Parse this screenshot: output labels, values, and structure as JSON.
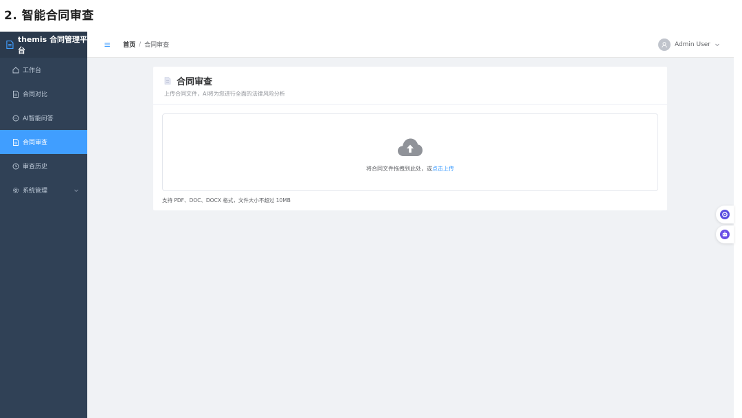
{
  "doc": {
    "heading": "2. 智能合同审查"
  },
  "sidebar": {
    "brand": "themis 合同管理平台",
    "items": [
      {
        "label": "工作台",
        "icon": "home-icon"
      },
      {
        "label": "合同对比",
        "icon": "document-icon"
      },
      {
        "label": "AI智能问答",
        "icon": "chat-icon"
      },
      {
        "label": "合同审查",
        "icon": "document-icon",
        "active": true
      },
      {
        "label": "审查历史",
        "icon": "clock-icon"
      },
      {
        "label": "系统管理",
        "icon": "gear-icon",
        "expandable": true
      }
    ]
  },
  "header": {
    "menu_icon": "hamburger-icon",
    "breadcrumb": {
      "home": "首页",
      "separator": "/",
      "current": "合同审查"
    },
    "user": {
      "name": "Admin User"
    }
  },
  "card": {
    "title": "合同审查",
    "subtitle": "上传合同文件，AI将为您进行全面的法律风险分析",
    "upload": {
      "prompt": "将合同文件拖拽到此处，或",
      "link": "点击上传"
    },
    "tip": "支持 PDF、DOC、DOCX 格式，文件大小不超过 10MB"
  },
  "colors": {
    "sidebar_bg": "#304156",
    "active_bg": "#409eff",
    "page_bg": "#f0f2f5",
    "link": "#409eff"
  }
}
